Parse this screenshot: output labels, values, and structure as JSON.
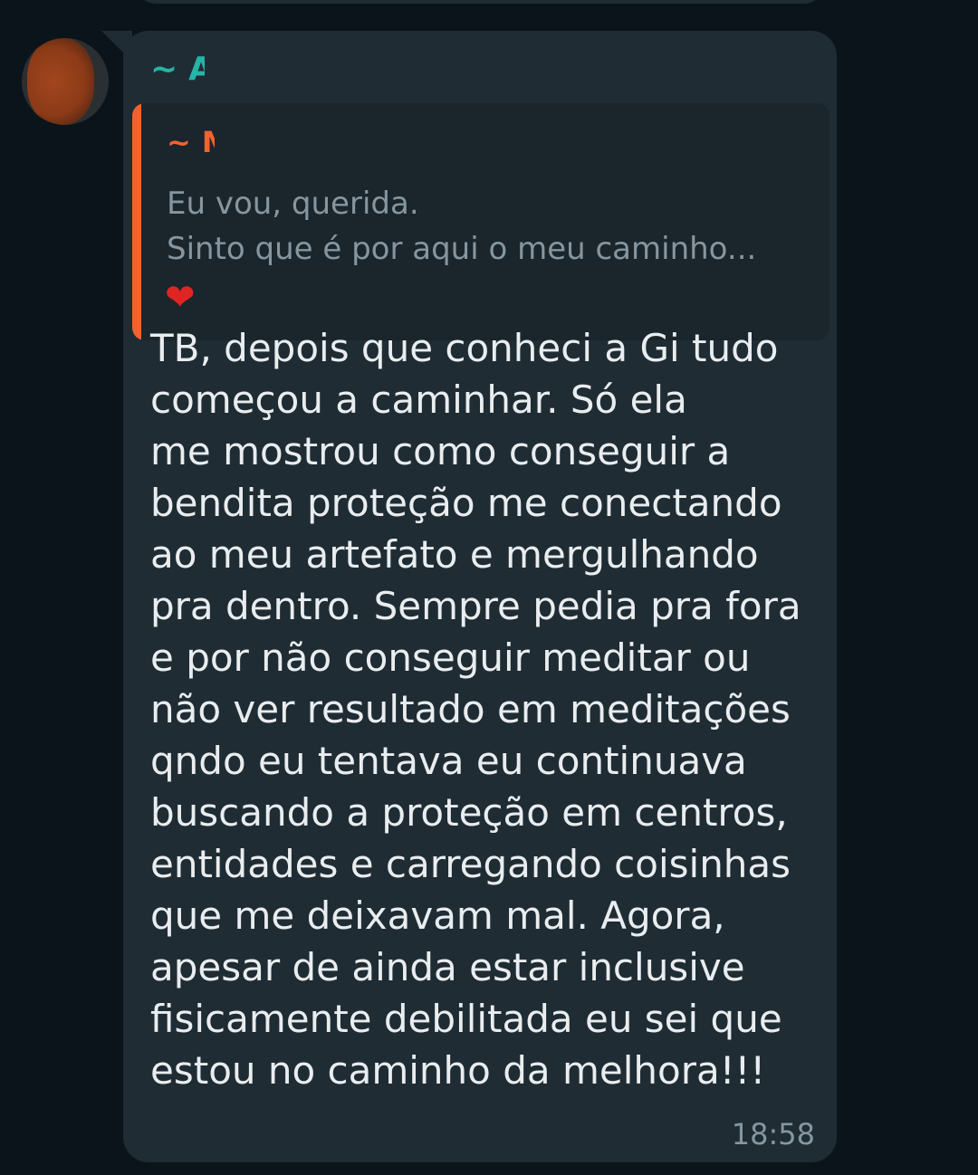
{
  "chat": {
    "message": {
      "sender": {
        "tilde": "~",
        "initial": "A"
      },
      "quoted": {
        "author_tilde": "~",
        "author_initial": "M",
        "text": "Eu vou, querida.\nSinto que é por aqui o meu caminho...",
        "emoji": "❤"
      },
      "body": "TB, depois que conheci a Gi tudo\ncomeçou a caminhar. Só ela\nme mostrou como conseguir a\nbendita proteção me conectando\nao meu artefato e mergulhando\npra dentro. Sempre pedia pra fora\ne por não conseguir meditar ou\nnão ver resultado em meditações\nqndo eu tentava eu continuava\nbuscando a proteção em centros,\nentidades e carregando coisinhas\nque me deixavam mal. Agora,\napesar de ainda estar inclusive\nfisicamente debilitada eu sei que\nestou no caminho da melhora!!!",
      "time": "18:58"
    }
  },
  "colors": {
    "background": "#0b141a",
    "bubble": "#1f2c34",
    "sender_name": "#25b4a5",
    "quote_accent": "#f0632f",
    "body_text": "#e9edef",
    "muted_text": "#8696a0"
  }
}
